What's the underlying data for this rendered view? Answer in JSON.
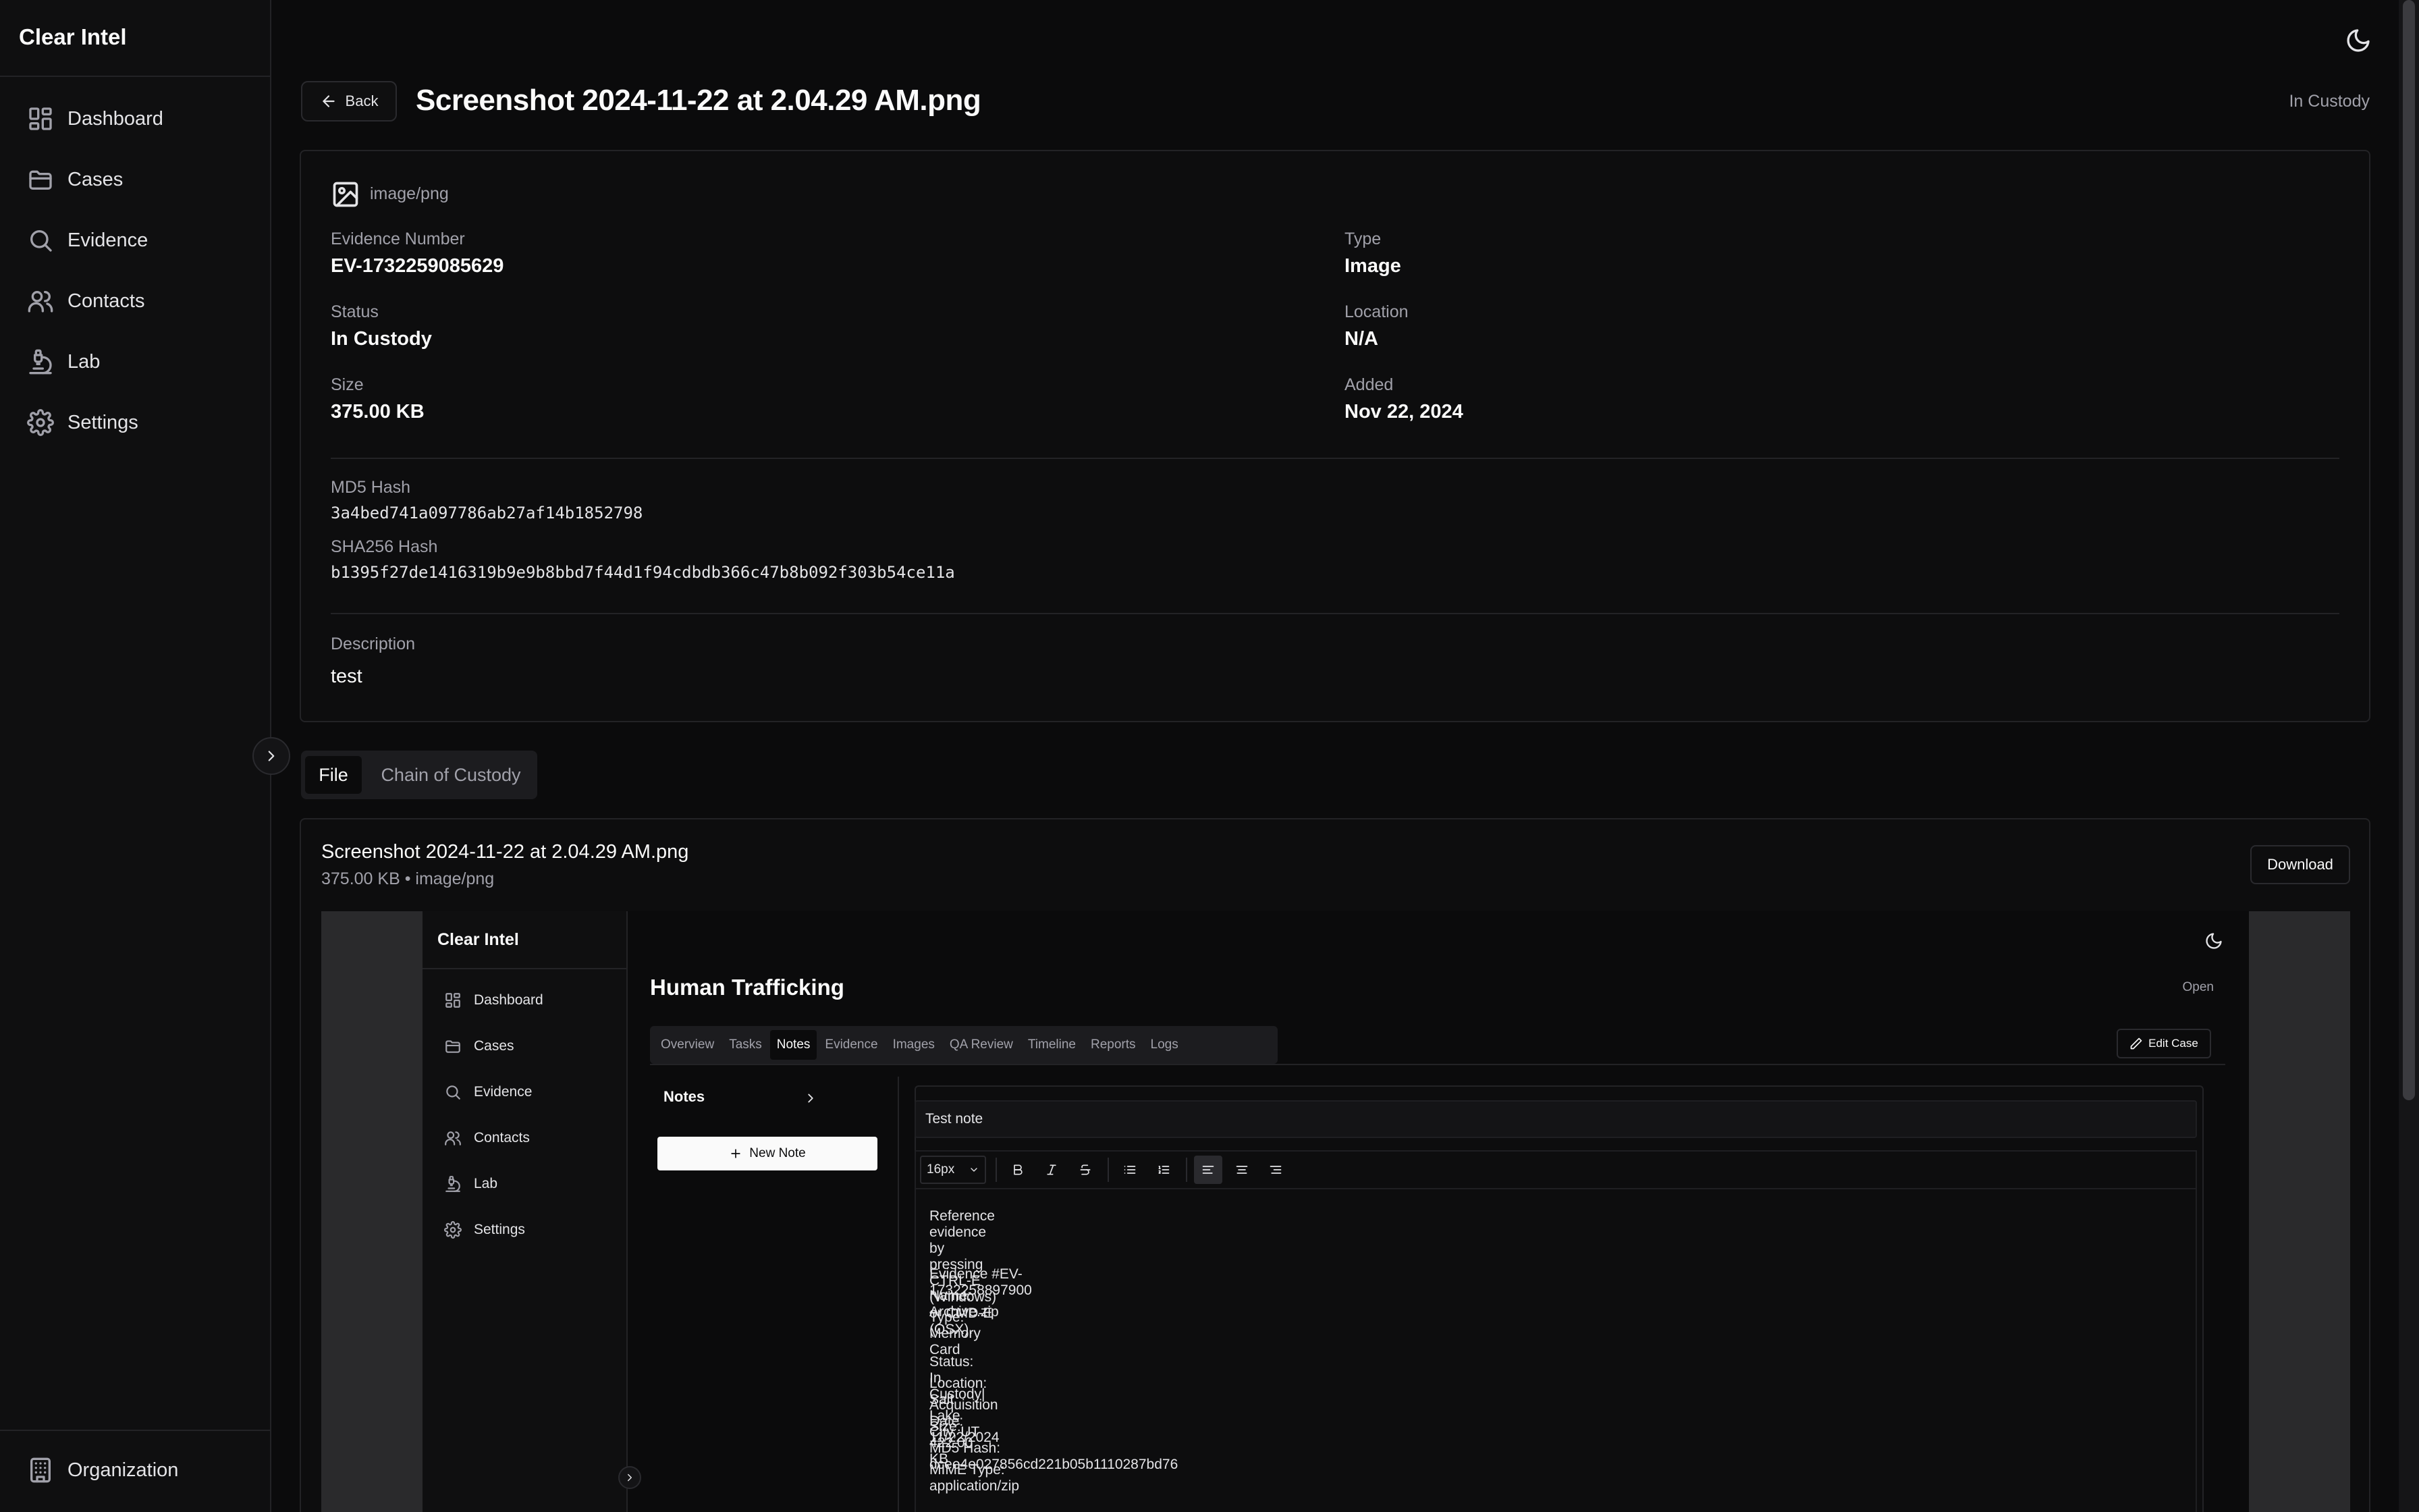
{
  "app": {
    "brand": "Clear Intel"
  },
  "sidebar": {
    "items": [
      {
        "label": "Dashboard",
        "icon": "dashboard-icon"
      },
      {
        "label": "Cases",
        "icon": "folder-icon"
      },
      {
        "label": "Evidence",
        "icon": "search-icon"
      },
      {
        "label": "Contacts",
        "icon": "users-icon"
      },
      {
        "label": "Lab",
        "icon": "microscope-icon"
      },
      {
        "label": "Settings",
        "icon": "gear-icon"
      }
    ],
    "bottom": {
      "label": "Organization",
      "icon": "building-icon"
    }
  },
  "header": {
    "back_label": "Back",
    "title": "Screenshot 2024-11-22 at 2.04.29 AM.png",
    "status": "In Custody"
  },
  "details": {
    "mime": "image/png",
    "evidence_number": {
      "label": "Evidence Number",
      "value": "EV-1732259085629"
    },
    "type": {
      "label": "Type",
      "value": "Image"
    },
    "status": {
      "label": "Status",
      "value": "In Custody"
    },
    "location": {
      "label": "Location",
      "value": "N/A"
    },
    "size": {
      "label": "Size",
      "value": "375.00 KB"
    },
    "added": {
      "label": "Added",
      "value": "Nov 22, 2024"
    },
    "md5": {
      "label": "MD5 Hash",
      "value": "3a4bed741a097786ab27af14b1852798"
    },
    "sha256": {
      "label": "SHA256 Hash",
      "value": "b1395f27de1416319b9e9b8bbd7f44d1f94cdbdb366c47b8b092f303b54ce11a"
    },
    "description": {
      "label": "Description",
      "value": "test"
    }
  },
  "tabs": {
    "file": "File",
    "custody": "Chain of Custody"
  },
  "file": {
    "name": "Screenshot 2024-11-22 at 2.04.29 AM.png",
    "meta": "375.00 KB • image/png",
    "download_label": "Download"
  },
  "preview": {
    "brand": "Clear Intel",
    "nav": [
      "Dashboard",
      "Cases",
      "Evidence",
      "Contacts",
      "Lab",
      "Settings"
    ],
    "case_title": "Human Trafficking",
    "case_status": "Open",
    "tabs": [
      "Overview",
      "Tasks",
      "Notes",
      "Evidence",
      "Images",
      "QA Review",
      "Timeline",
      "Reports",
      "Logs"
    ],
    "active_tab": "Notes",
    "edit_label": "Edit Case",
    "notes_heading": "Notes",
    "new_note_label": "New Note",
    "note_title": "Test note",
    "font_size": "16px",
    "lines": [
      "Reference evidence by pressing CTRL-E (Windows) or CMD-E (OSX).",
      "Evidence #EV-1732258897900",
      "Name: Archive.zip",
      "Type: Memory Card",
      "Status: In Custody|",
      "Location: Salt Lake City, UT",
      "Acquisition Date: 11/22/2024",
      "Size: 422.00 KB",
      "MD5 Hash: dcee4e027856cd221b05b1110287bd76",
      "MIME Type: application/zip"
    ]
  }
}
